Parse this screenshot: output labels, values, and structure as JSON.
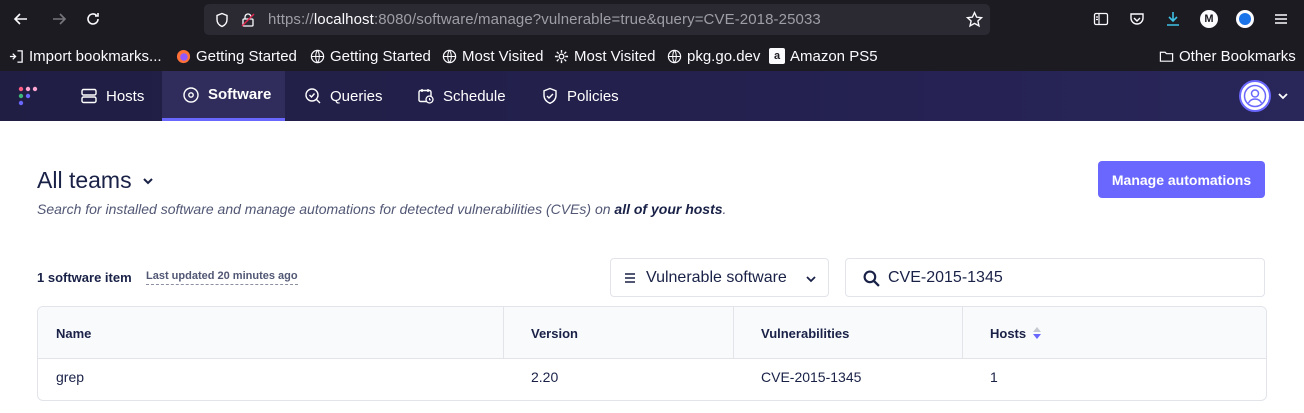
{
  "browser": {
    "url_prefix": "https://",
    "url_host": "localhost",
    "url_rest": ":8080/software/manage?vulnerable=true&query=CVE-2018-25033",
    "bookmarks": [
      {
        "label": "Import bookmarks...",
        "icon": "import-icon"
      },
      {
        "label": "Getting Started",
        "icon": "firefox-icon"
      },
      {
        "label": "Getting Started",
        "icon": "globe-icon"
      },
      {
        "label": "Most Visited",
        "icon": "globe-icon"
      },
      {
        "label": "Most Visited",
        "icon": "gear-icon"
      },
      {
        "label": "pkg.go.dev",
        "icon": "globe-icon"
      },
      {
        "label": "Amazon PS5",
        "icon": "amazon-icon"
      }
    ],
    "other_bookmarks": "Other Bookmarks",
    "profile_letter": "M"
  },
  "nav": {
    "items": [
      {
        "label": "Hosts",
        "icon": "hosts-icon"
      },
      {
        "label": "Software",
        "icon": "software-icon",
        "active": true
      },
      {
        "label": "Queries",
        "icon": "queries-icon"
      },
      {
        "label": "Schedule",
        "icon": "schedule-icon"
      },
      {
        "label": "Policies",
        "icon": "policies-icon"
      }
    ]
  },
  "header": {
    "team": "All teams",
    "description": "Search for installed software and manage automations for detected vulnerabilities (CVEs) on",
    "description_bold": "all of your hosts",
    "description_end": ".",
    "manage_button": "Manage automations"
  },
  "toolbar": {
    "count": "1 software item",
    "updated": "Last updated 20 minutes ago",
    "filter_value": "Vulnerable software",
    "search_value": "CVE-2015-1345"
  },
  "table": {
    "headers": [
      "Name",
      "Version",
      "Vulnerabilities",
      "Hosts"
    ],
    "rows": [
      [
        "grep",
        "2.20",
        "CVE-2015-1345",
        "1"
      ]
    ]
  },
  "colors": {
    "accent": "#6a67fe",
    "nav_bg": "#201e43",
    "text": "#192147"
  }
}
